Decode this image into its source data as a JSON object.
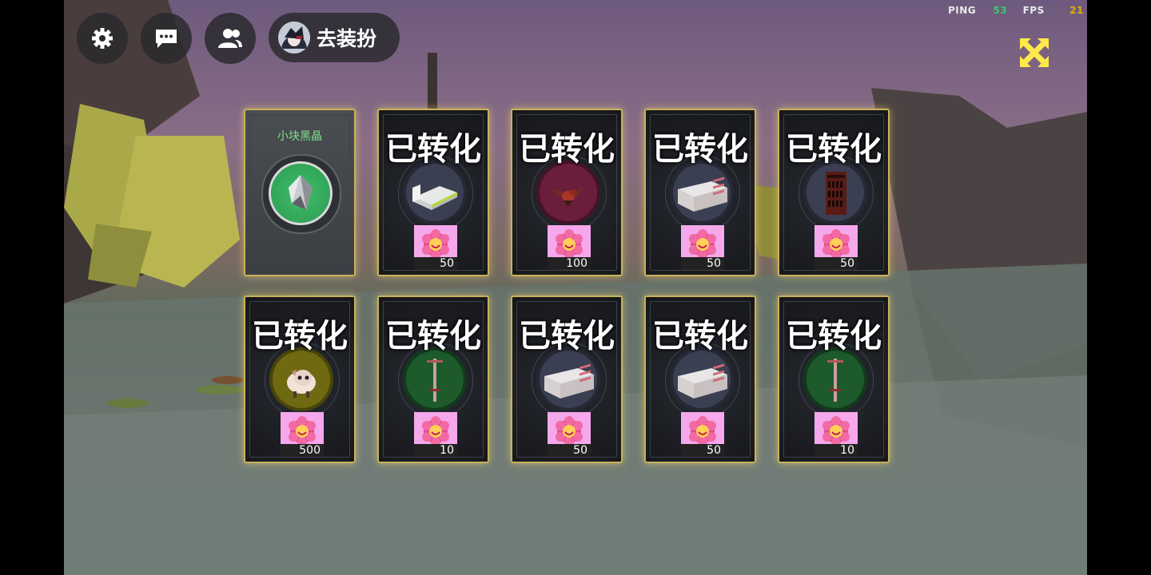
{
  "hud": {
    "dressup_label": "去装扮",
    "stats": {
      "ping_label": "PING",
      "ping_value": "53",
      "fps_label": "FPS",
      "fps_value": "21"
    },
    "colors": {
      "ping": "#3ec46d",
      "fps": "#e0b000",
      "close": "#ffe94a"
    }
  },
  "cards": [
    {
      "kind": "crystal",
      "title": "小块黑晶"
    },
    {
      "kind": "converted",
      "overlay": "已转化",
      "item": "bed",
      "disc_color": "#3b3f52",
      "token_count": "50"
    },
    {
      "kind": "converted",
      "overlay": "已转化",
      "item": "bird",
      "disc_color": "#6b1e3b",
      "token_count": "100"
    },
    {
      "kind": "converted",
      "overlay": "已转化",
      "item": "desk",
      "disc_color": "#3b3f52",
      "token_count": "50"
    },
    {
      "kind": "converted",
      "overlay": "已转化",
      "item": "wine-rack",
      "disc_color": "#3b3f52",
      "token_count": "50"
    },
    {
      "kind": "converted",
      "overlay": "已转化",
      "item": "sheep",
      "disc_color": "#6f6a12",
      "token_count": "500"
    },
    {
      "kind": "converted",
      "overlay": "已转化",
      "item": "pogo-stick",
      "disc_color": "#1d5a2c",
      "token_count": "10"
    },
    {
      "kind": "converted",
      "overlay": "已转化",
      "item": "desk",
      "disc_color": "#3b3f52",
      "token_count": "50"
    },
    {
      "kind": "converted",
      "overlay": "已转化",
      "item": "desk",
      "disc_color": "#3b3f52",
      "token_count": "50"
    },
    {
      "kind": "converted",
      "overlay": "已转化",
      "item": "pogo-stick",
      "disc_color": "#1d5a2c",
      "token_count": "10"
    }
  ]
}
